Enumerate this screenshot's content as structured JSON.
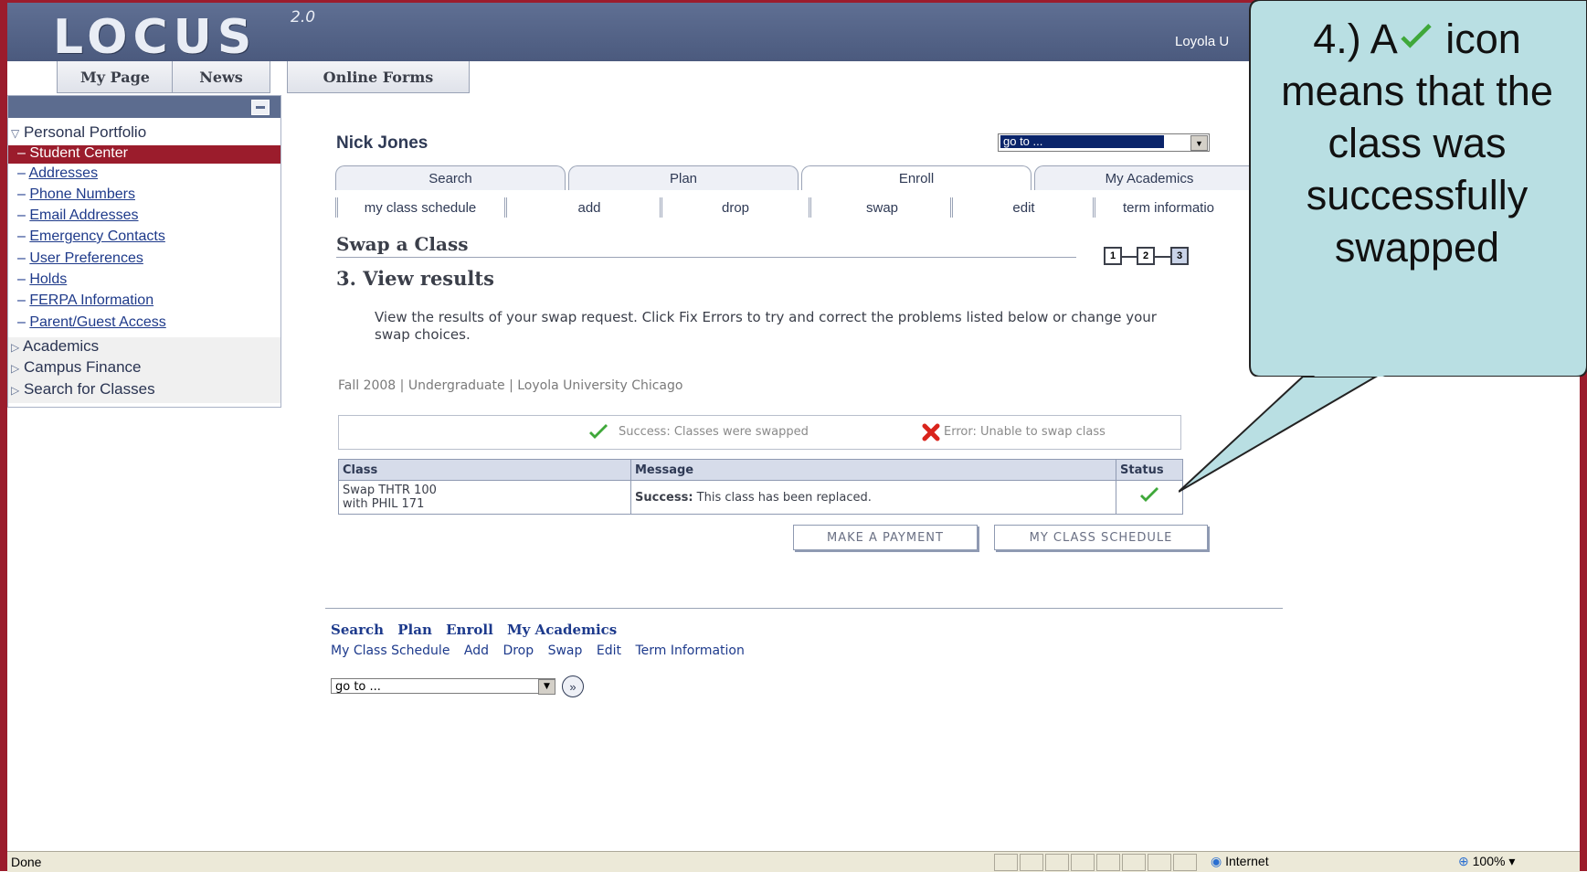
{
  "app": {
    "logo": "LOCUS",
    "version": "2.0",
    "org": "Loyola U"
  },
  "nav": {
    "tabs": [
      "My Page",
      "News",
      "Online Forms"
    ]
  },
  "sidebar": {
    "section_portfolio": "Personal Portfolio",
    "items": [
      {
        "label": "Student Center",
        "active": true
      },
      {
        "label": "Addresses"
      },
      {
        "label": "Phone Numbers"
      },
      {
        "label": "Email Addresses"
      },
      {
        "label": "Emergency Contacts"
      },
      {
        "label": "User Preferences"
      },
      {
        "label": "Holds"
      },
      {
        "label": "FERPA Information"
      },
      {
        "label": "Parent/Guest Access"
      }
    ],
    "sections": [
      "Academics",
      "Campus Finance",
      "Search for Classes"
    ]
  },
  "student": {
    "name": "Nick Jones"
  },
  "goto": {
    "top_value": "go to ...",
    "bottom_value": "go to ..."
  },
  "tabs": {
    "main": [
      "Search",
      "Plan",
      "Enroll",
      "My Academics"
    ],
    "active": "Enroll",
    "sub": [
      "my class schedule",
      "add",
      "drop",
      "swap",
      "edit",
      "term informatio"
    ],
    "active_sub": "swap"
  },
  "page": {
    "title": "Swap a Class",
    "step_title": "3.  View results",
    "steps": [
      "1",
      "2",
      "3"
    ],
    "instructions": "View the results of your swap request.  Click Fix Errors to try and correct the problems listed below or change your swap choices.",
    "term": "Fall 2008 | Undergraduate | Loyola University Chicago"
  },
  "legend": {
    "success": "Success: Classes were swapped",
    "error": "Error: Unable to swap class"
  },
  "results": {
    "headers": [
      "Class",
      "Message",
      "Status"
    ],
    "rows": [
      {
        "class_line1": "Swap THTR  100",
        "class_line2": "with PHIL  171",
        "message_bold": "Success:",
        "message": " This class has been replaced.",
        "status": "success"
      }
    ]
  },
  "buttons": {
    "payment": "MAKE A PAYMENT",
    "schedule": "MY CLASS SCHEDULE"
  },
  "footer_links": {
    "row1": [
      "Search",
      "Plan",
      "Enroll",
      "My Academics"
    ],
    "row2": [
      "My Class Schedule",
      "Add",
      "Drop",
      "Swap",
      "Edit",
      "Term Information"
    ]
  },
  "statusbar": {
    "text": "Done",
    "zone": "Internet",
    "zoom": "100%"
  },
  "callout": {
    "part1": "4.) A",
    "part2": " icon means that the class was successfully swapped"
  },
  "colors": {
    "frame": "#9b1c2c",
    "header": "#5c6c8f",
    "success": "#3fa83a",
    "error": "#d9241c",
    "callout": "#b9dfe3"
  }
}
